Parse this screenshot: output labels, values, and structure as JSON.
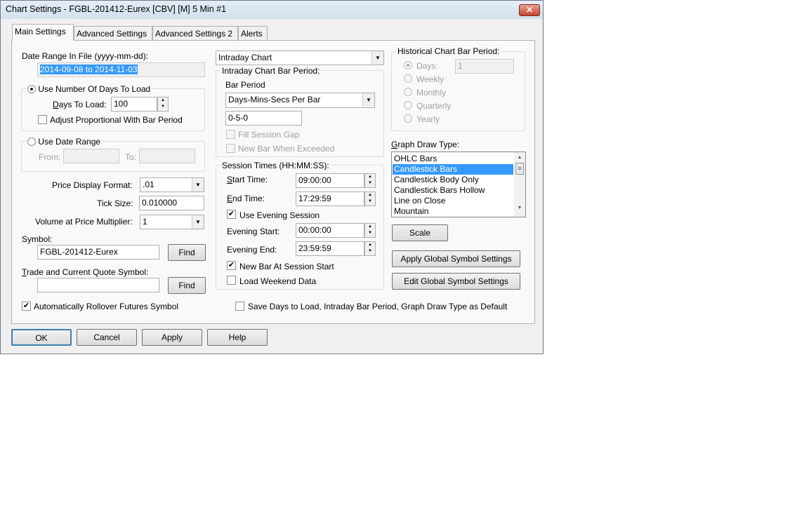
{
  "window": {
    "title": "Chart Settings - FGBL-201412-Eurex [CBV] [M]  5 Min   #1",
    "close": "✕"
  },
  "tabs": [
    "Main Settings",
    "Advanced Settings",
    "Advanced Settings 2",
    "Alerts"
  ],
  "left": {
    "date_range_label": "Date Range In File (yyyy-mm-dd):",
    "date_range_value": "2014-09-08 to 2014-11-03",
    "use_days_label": "Use Number Of Days To Load",
    "days_to_load_label": "Days To Load:",
    "days_to_load_value": "100",
    "adjust_label": "Adjust Proportional With Bar Period",
    "use_date_range_label": "Use Date Range",
    "from_label": "From:",
    "to_label": "To:",
    "price_format_label": "Price Display Format:",
    "price_format_value": ".01",
    "tick_size_label": "Tick Size:",
    "tick_size_value": "0.010000",
    "vap_label": "Volume at Price Multiplier:",
    "vap_value": "1",
    "symbol_label": "Symbol:",
    "symbol_value": "FGBL-201412-Eurex",
    "find": "Find",
    "trade_symbol_label": "Trade and Current Quote Symbol:",
    "trade_symbol_value": "",
    "rollover_label": "Automatically Rollover Futures Symbol"
  },
  "middle": {
    "chart_type": "Intraday Chart",
    "bar_period_group": "Intraday Chart Bar Period:",
    "bar_period_label": "Bar Period",
    "bar_period_type": "Days-Mins-Secs Per Bar",
    "bar_period_value": "0-5-0",
    "fill_gap": "Fill Session Gap",
    "new_bar_exceeded": "New Bar When Exceeded",
    "session_group": "Session Times (HH:MM:SS):",
    "start_label": "Start Time:",
    "start_value": "09:00:00",
    "end_label": "End Time:",
    "end_value": "17:29:59",
    "use_evening": "Use Evening Session",
    "evening_start_label": "Evening Start:",
    "evening_start_value": "00:00:00",
    "evening_end_label": "Evening End:",
    "evening_end_value": "23:59:59",
    "new_bar_session": "New Bar At Session Start",
    "load_weekend": "Load Weekend Data",
    "save_default": "Save Days to Load, Intraday Bar Period, Graph Draw Type as Default"
  },
  "right": {
    "hist_group": "Historical Chart Bar Period:",
    "days": "Days:",
    "days_value": "1",
    "weekly": "Weekly",
    "monthly": "Monthly",
    "quarterly": "Quarterly",
    "yearly": "Yearly",
    "draw_type_label": "Graph Draw Type:",
    "draw_types": [
      "OHLC Bars",
      "Candlestick Bars",
      "Candlestick Body Only",
      "Candlestick Bars Hollow",
      "Line on Close",
      "Mountain"
    ],
    "scale": "Scale",
    "apply_global": "Apply Global Symbol Settings",
    "edit_global": "Edit Global Symbol Settings"
  },
  "footer": {
    "ok": "OK",
    "cancel": "Cancel",
    "apply": "Apply",
    "help": "Help"
  }
}
